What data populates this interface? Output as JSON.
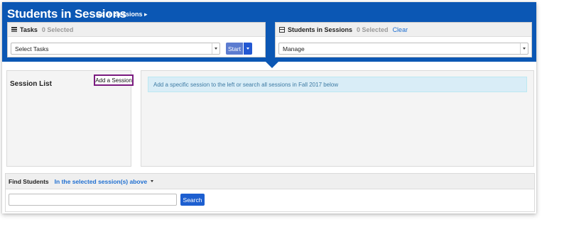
{
  "header": {
    "title": "Students in Sessions",
    "go_to_sessions": "Go to Sessions ▸"
  },
  "tasks_panel": {
    "title": "Tasks",
    "selected_count": "0 Selected",
    "select_value": "Select Tasks",
    "start_label": "Start"
  },
  "students_panel": {
    "title": "Students in Sessions",
    "selected_count": "0 Selected",
    "clear_label": "Clear",
    "manage_value": "Manage"
  },
  "session_list": {
    "title": "Session List",
    "add_button": "Add a Session"
  },
  "info_message": "Add a specific session to the left or search all sessions in Fall 2017 below",
  "find_students": {
    "title": "Find Students",
    "scope_label": "In the selected session(s) above",
    "search_value": "",
    "search_button": "Search"
  },
  "colors": {
    "header_blue": "#0b57b4",
    "button_blue": "#1d5fd0",
    "highlight_purple": "#7a1a7f",
    "info_bg": "#d9edf7"
  }
}
